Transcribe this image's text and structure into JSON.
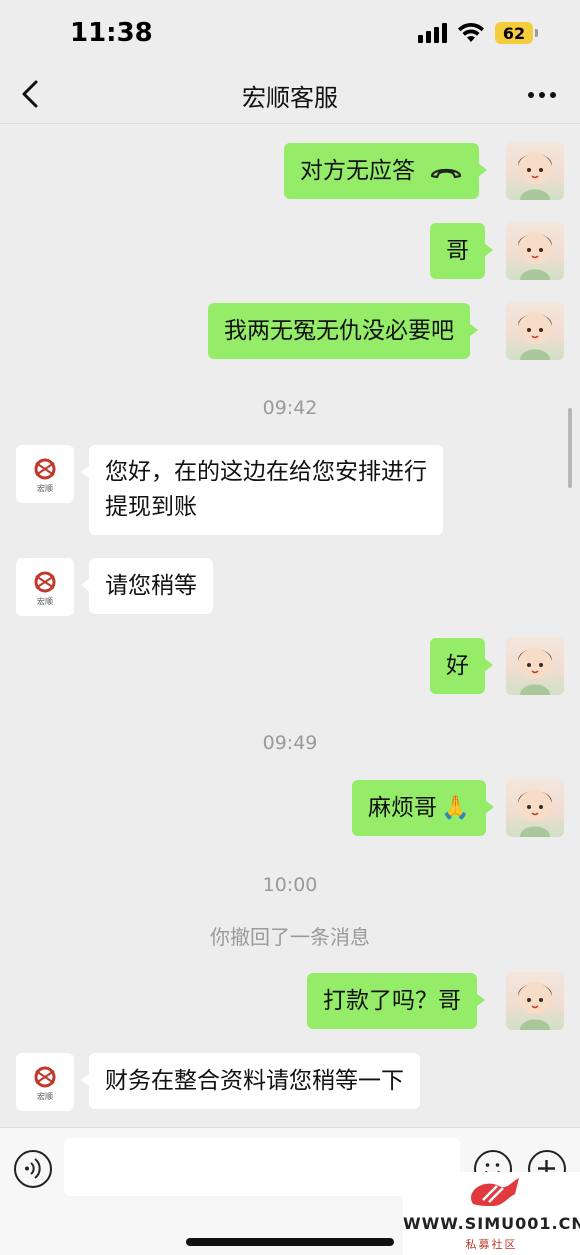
{
  "status_bar": {
    "time": "11:38",
    "battery": "62"
  },
  "nav": {
    "title": "宏顺客服"
  },
  "service_avatar": {
    "logo_text": "宏顺"
  },
  "messages": [
    {
      "type": "out",
      "text": "对方无应答",
      "icon": "phone-hangup-icon"
    },
    {
      "type": "out",
      "text": "哥"
    },
    {
      "type": "out",
      "text": "我两无冤无仇没必要吧"
    },
    {
      "type": "time",
      "text": "09:42"
    },
    {
      "type": "in",
      "lines": [
        "您好，在的这边在给您安排进行",
        "提现到账"
      ]
    },
    {
      "type": "in",
      "text": "请您稍等"
    },
    {
      "type": "out",
      "text": "好"
    },
    {
      "type": "time",
      "text": "09:49"
    },
    {
      "type": "out",
      "text": "麻烦哥",
      "emoji": "🙏"
    },
    {
      "type": "time",
      "text": "10:00"
    },
    {
      "type": "recall",
      "text": "你撤回了一条消息"
    },
    {
      "type": "out",
      "text": "打款了吗？哥"
    },
    {
      "type": "in",
      "text": "财务在整合资料请您稍等一下"
    }
  ],
  "input_bar": {
    "placeholder": ""
  },
  "watermark": {
    "url": "WWW.SIMU001.CN",
    "sub": "私募社区"
  },
  "colors": {
    "outgoing_bubble": "#95ec69",
    "incoming_bubble": "#ffffff",
    "background": "#ededed"
  }
}
